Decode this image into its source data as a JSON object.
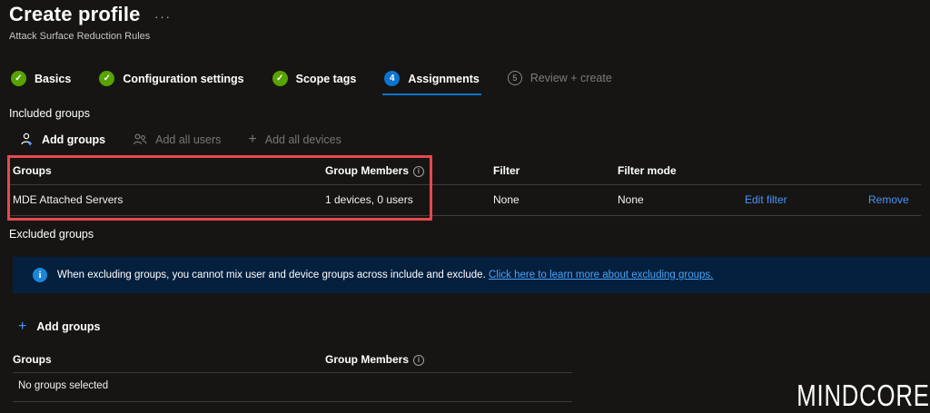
{
  "header": {
    "title": "Create profile",
    "menu_dots": "···",
    "subtitle": "Attack Surface Reduction Rules"
  },
  "wizard": {
    "steps": [
      {
        "label": "Basics",
        "state": "complete",
        "icon": "check-icon"
      },
      {
        "label": "Configuration settings",
        "state": "complete",
        "icon": "check-icon"
      },
      {
        "label": "Scope tags",
        "state": "complete",
        "icon": "check-icon"
      },
      {
        "label": "Assignments",
        "state": "current",
        "number": "4"
      },
      {
        "label": "Review + create",
        "state": "upcoming",
        "number": "5"
      }
    ]
  },
  "included_groups": {
    "heading": "Included groups",
    "toolbar": [
      {
        "label": "Add groups",
        "icon": "person-add-icon",
        "enabled": true
      },
      {
        "label": "Add all users",
        "icon": "people-icon",
        "enabled": false
      },
      {
        "label": "Add all devices",
        "icon": "plus-icon",
        "enabled": false
      }
    ],
    "table": {
      "headers": {
        "groups": "Groups",
        "members": "Group Members",
        "filter": "Filter",
        "filter_mode": "Filter mode"
      },
      "info_icon": "info-icon",
      "rows": [
        {
          "group": "MDE Attached Servers",
          "members": "1 devices, 0 users",
          "filter": "None",
          "filter_mode": "None",
          "actions": [
            "Edit filter",
            "Remove"
          ]
        }
      ]
    }
  },
  "excluded_groups": {
    "heading": "Excluded groups",
    "banner": {
      "icon": "info-icon",
      "text": "When excluding groups, you cannot mix user and device groups across include and exclude.",
      "link": "Click here to learn more about excluding groups."
    },
    "add_groups_label": "Add groups",
    "table": {
      "headers": {
        "groups": "Groups",
        "members": "Group Members"
      },
      "empty_text": "No groups selected"
    }
  },
  "annotation": {
    "type": "red-highlight-box"
  },
  "watermark": "MINDCORE",
  "colors": {
    "background": "#161513",
    "accent_blue": "#0b74d0",
    "link_blue": "#4894fe",
    "success_green": "#57a300",
    "banner_bg": "#04203e",
    "annotation_red": "#e8484f"
  }
}
